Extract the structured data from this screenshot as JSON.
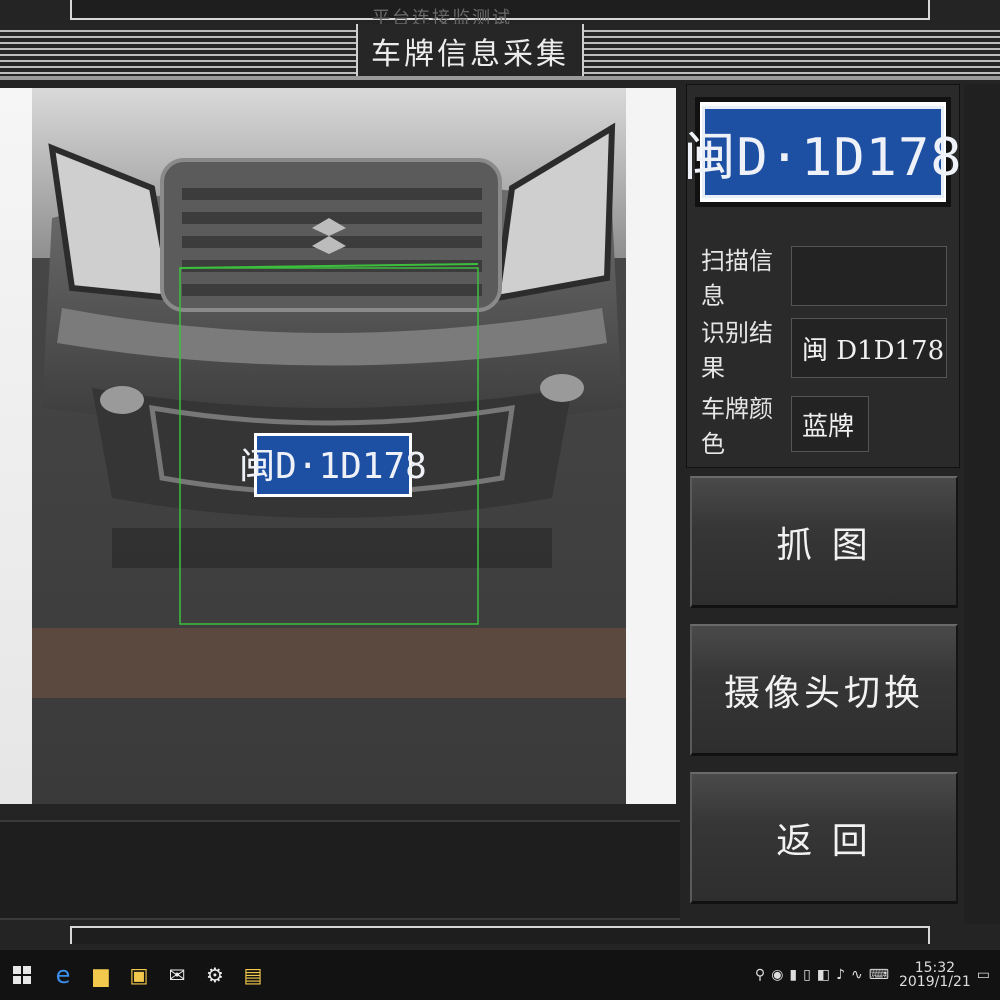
{
  "window": {
    "title": "车牌信息采集",
    "top_ghost_title": "平台连接监测试"
  },
  "camera": {
    "plate_text": "闽D·1D178"
  },
  "result_panel": {
    "plate_image_text": "闽D·1D178",
    "scan_info": {
      "label": "扫描信息",
      "value": ""
    },
    "recognition": {
      "label": "识别结果",
      "value": "闽 D1D178"
    },
    "plate_color": {
      "label": "车牌颜色",
      "value": "蓝牌"
    }
  },
  "buttons": {
    "capture": "抓 图",
    "switch_camera": "摄像头切换",
    "back": "返 回"
  },
  "log": {
    "lines": [
      "",
      ""
    ]
  },
  "taskbar": {
    "clock_time": "15:32",
    "clock_date": "2019/1/21"
  },
  "colors": {
    "plate_blue": "#1d4fa3",
    "log_text": "#2c57b8",
    "detection_line": "#3cbf3c"
  }
}
